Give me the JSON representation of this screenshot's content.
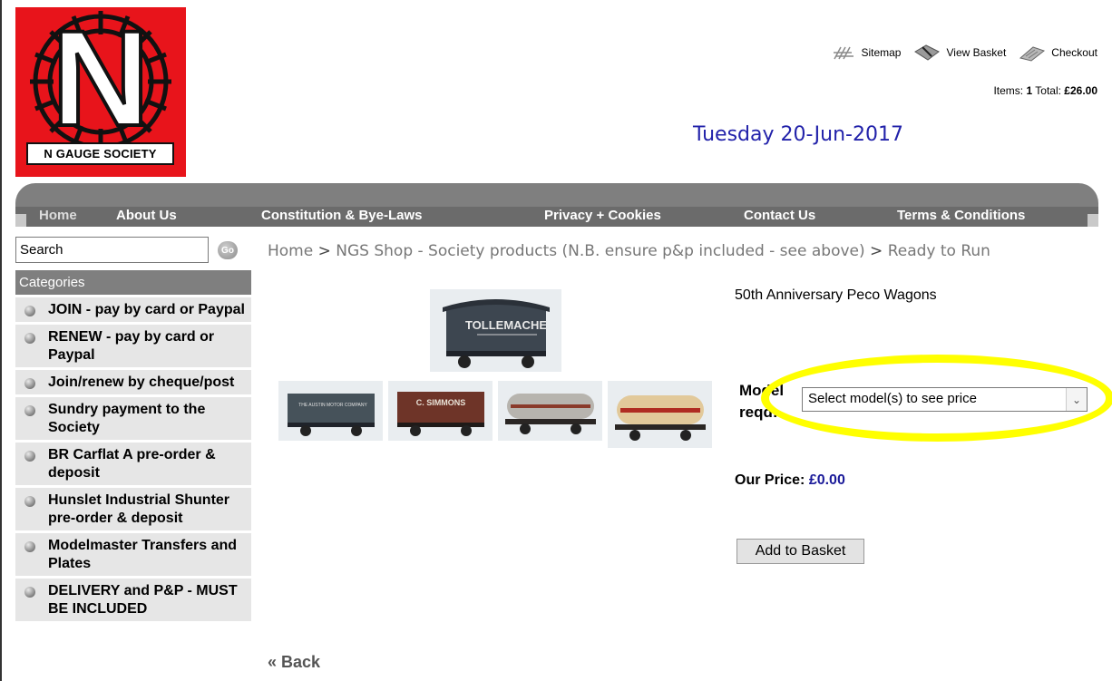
{
  "brand": {
    "logo_letter": "N",
    "logo_caption": "N GAUGE SOCIETY",
    "red": "#e8141b"
  },
  "toplinks": {
    "sitemap": "Sitemap",
    "view_basket": "View Basket",
    "checkout": "Checkout",
    "items_label": "Items:",
    "items_count": "1",
    "total_label": "Total:",
    "total_value": "£26.00"
  },
  "date": "Tuesday 20-Jun-2017",
  "nav": {
    "home": "Home",
    "about": "About Us",
    "constitution": "Constitution & Bye-Laws",
    "privacy": "Privacy + Cookies",
    "contact": "Contact Us",
    "terms": "Terms & Conditions"
  },
  "search": {
    "value": "Search",
    "go": "Go"
  },
  "categories": {
    "heading": "Categories",
    "items": [
      "JOIN - pay by card or Paypal",
      "RENEW - pay by card or Paypal",
      "Join/renew by cheque/post",
      "Sundry payment to the Society",
      "BR Carflat A pre-order & deposit",
      "Hunslet Industrial Shunter pre-order & deposit",
      "Modelmaster Transfers and Plates",
      "DELIVERY and P&P - MUST BE INCLUDED"
    ]
  },
  "breadcrumb": {
    "home": "Home",
    "sep1": ">",
    "shop": "NGS Shop - Society products (N.B. ensure p&p included - see above)",
    "sep2": ">",
    "current": "Ready to Run"
  },
  "product": {
    "title": "50th Anniversary Peco Wagons",
    "model_label_1": "Model",
    "model_label_2": "reqd:",
    "select_value": "Select model(s) to see price",
    "price_label": "Our Price:",
    "price_value": "£0.00",
    "add_button": "Add to Basket",
    "highlight_color": "#ffff00"
  },
  "wagons": {
    "main_text": "TOLLEMACHE",
    "w1_text": "THE AUSTIN MOTOR COMPANY",
    "w2_text": "C. SIMMONS"
  },
  "back": "« Back"
}
